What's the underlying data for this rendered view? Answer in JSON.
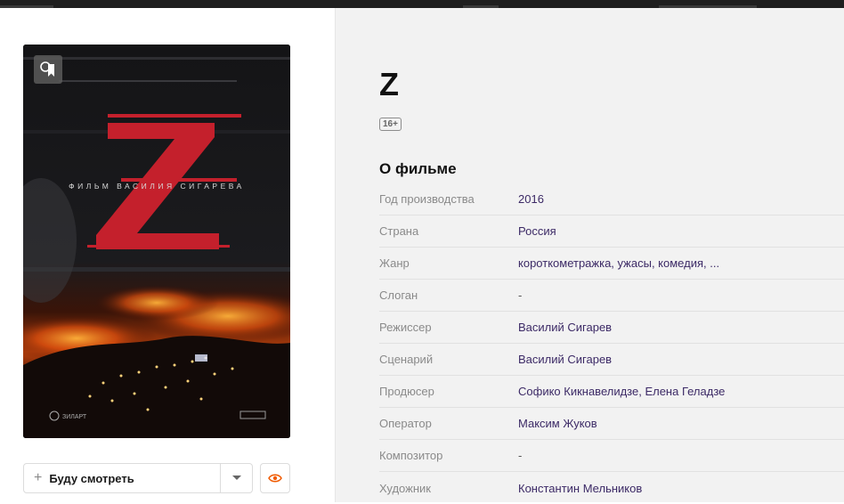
{
  "film": {
    "title": "Z",
    "age_rating": "16+"
  },
  "poster": {
    "title_letter": "Z",
    "tagline": "ФИЛЬМ ВАСИЛИЯ СИГАРЕВА",
    "studio_logo": "ЗИЛАРТ",
    "accent_color": "#c4202c"
  },
  "actions": {
    "watch_label": "Буду смотреть",
    "plus_icon": "+"
  },
  "about": {
    "section_title": "О фильме",
    "rows": [
      {
        "label": "Год производства",
        "value": "2016"
      },
      {
        "label": "Страна",
        "value": "Россия"
      },
      {
        "label": "Жанр",
        "value": "короткометражка, ужасы, комедия, ..."
      },
      {
        "label": "Слоган",
        "value": "-"
      },
      {
        "label": "Режиссер",
        "value": "Василий Сигарев"
      },
      {
        "label": "Сценарий",
        "value": "Василий Сигарев"
      },
      {
        "label": "Продюсер",
        "value": "Софико Кикнавелидзе, Елена Геладзе"
      },
      {
        "label": "Оператор",
        "value": "Максим Жуков"
      },
      {
        "label": "Композитор",
        "value": "-"
      },
      {
        "label": "Художник",
        "value": "Константин Мельников"
      }
    ]
  },
  "colors": {
    "link": "#3c2a66",
    "label": "#8a8a8a",
    "eye_accent": "#f05a00",
    "panel_bg": "#f2f2f2"
  }
}
